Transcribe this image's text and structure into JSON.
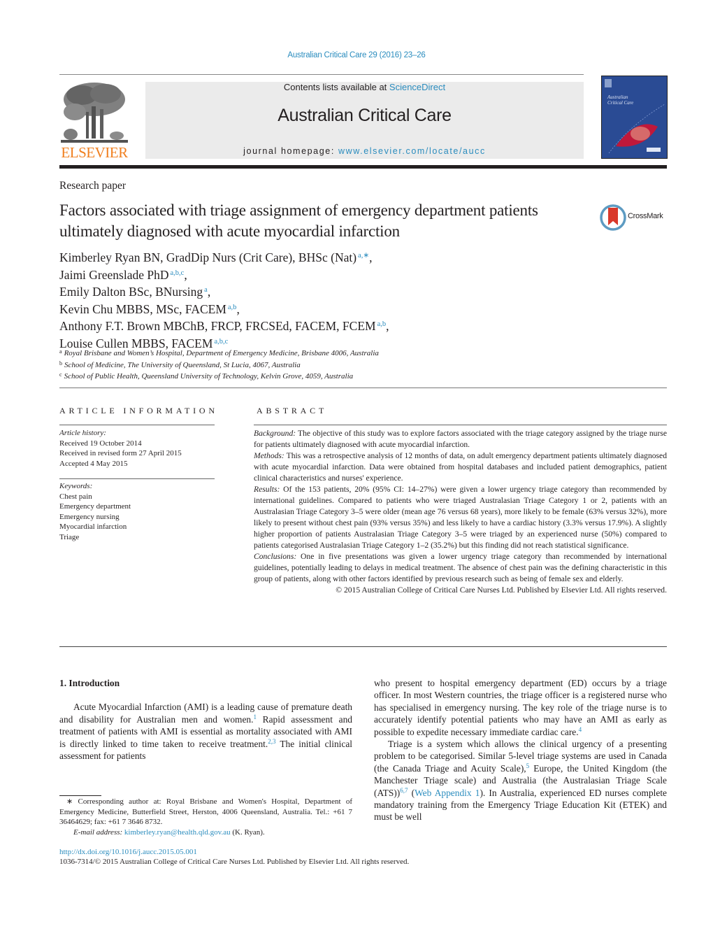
{
  "header": {
    "journal_reference": "Australian Critical Care 29 (2016) 23–26",
    "contents_prefix": "Contents lists available at ",
    "contents_link": "ScienceDirect",
    "journal_title": "Australian Critical Care",
    "homepage_prefix": "journal homepage: ",
    "homepage_link": "www.elsevier.com/locate/aucc",
    "publisher_logo": "ELSEVIER",
    "cover_title": "Australian Critical Care"
  },
  "article": {
    "type": "Research paper",
    "title": "Factors associated with triage assignment of emergency department patients ultimately diagnosed with acute myocardial infarction",
    "crossmark_label": "CrossMark",
    "authors": [
      {
        "name": "Kimberley Ryan BN, GradDip Nurs (Crit Care), BHSc (Nat)",
        "affil": "a,∗",
        "sep": ","
      },
      {
        "name": "Jaimi Greenslade PhD",
        "affil": "a,b,c",
        "sep": ","
      },
      {
        "name": "Emily Dalton BSc, BNursing",
        "affil": "a",
        "sep": ","
      },
      {
        "name": "Kevin Chu MBBS, MSc, FACEM",
        "affil": "a,b",
        "sep": ","
      },
      {
        "name": "Anthony F.T. Brown MBChB, FRCP, FRCSEd, FACEM, FCEM",
        "affil": "a,b",
        "sep": ","
      },
      {
        "name": "Louise Cullen MBBS, FACEM",
        "affil": "a,b,c",
        "sep": ""
      }
    ],
    "affiliations": [
      {
        "key": "a",
        "text": "Royal Brisbane and Women’s Hospital, Department of Emergency Medicine, Brisbane 4006, Australia"
      },
      {
        "key": "b",
        "text": "School of Medicine, The University of Queensland, St Lucia, 4067, Australia"
      },
      {
        "key": "c",
        "text": "School of Public Health, Queensland University of Technology, Kelvin Grove, 4059, Australia"
      }
    ]
  },
  "article_info": {
    "heading": "ARTICLE INFORMATION",
    "history_label": "Article history:",
    "history": [
      "Received 19 October 2014",
      "Received in revised form 27 April 2015",
      "Accepted 4 May 2015"
    ],
    "keywords_label": "Keywords:",
    "keywords": [
      "Chest pain",
      "Emergency department",
      "Emergency nursing",
      "Myocardial infarction",
      "Triage"
    ]
  },
  "abstract": {
    "heading": "ABSTRACT",
    "sections": [
      {
        "label": "Background:",
        "text": " The objective of this study was to explore factors associated with the triage category assigned by the triage nurse for patients ultimately diagnosed with acute myocardial infarction."
      },
      {
        "label": "Methods:",
        "text": " This was a retrospective analysis of 12 months of data, on adult emergency department patients ultimately diagnosed with acute myocardial infarction. Data were obtained from hospital databases and included patient demographics, patient clinical characteristics and nurses' experience."
      },
      {
        "label": "Results:",
        "text": " Of the 153 patients, 20% (95% CI: 14–27%) were given a lower urgency triage category than recommended by international guidelines. Compared to patients who were triaged Australasian Triage Category 1 or 2, patients with an Australasian Triage Category 3–5 were older (mean age 76 versus 68 years), more likely to be female (63% versus 32%), more likely to present without chest pain (93% versus 35%) and less likely to have a cardiac history (3.3% versus 17.9%). A slightly higher proportion of patients Australasian Triage Category 3–5 were triaged by an experienced nurse (50%) compared to patients categorised Australasian Triage Category 1–2 (35.2%) but this finding did not reach statistical significance."
      },
      {
        "label": "Conclusions:",
        "text": " One in five presentations was given a lower urgency triage category than recommended by international guidelines, potentially leading to delays in medical treatment. The absence of chest pain was the defining characteristic in this group of patients, along with other factors identified by previous research such as being of female sex and elderly."
      }
    ],
    "copyright": "© 2015 Australian College of Critical Care Nurses Ltd. Published by Elsevier Ltd. All rights reserved."
  },
  "body": {
    "intro_heading": "1.  Introduction",
    "left_p1_a": "Acute Myocardial Infarction (AMI) is a leading cause of premature death and disability for Australian men and women.",
    "left_p1_ref1": "1",
    "left_p1_b": " Rapid assessment and treatment of patients with AMI is essential as mortality associated with AMI is directly linked to time taken to receive treatment.",
    "left_p1_ref2": "2,3",
    "left_p1_c": " The initial clinical assessment for patients",
    "right_p1_a": "who present to hospital emergency department (ED) occurs by a triage officer. In most Western countries, the triage officer is a registered nurse who has specialised in emergency nursing. The key role of the triage nurse is to accurately identify potential patients who may have an AMI as early as possible to expedite necessary immediate cardiac care.",
    "right_p1_ref": "4",
    "right_p2_a": "Triage is a system which allows the clinical urgency of a presenting problem to be categorised. Similar 5-level triage systems are used in Canada (the Canada Triage and Acuity Scale),",
    "right_p2_ref1": "5",
    "right_p2_b": " Europe, the United Kingdom (the Manchester Triage scale) and Australia (the Australasian Triage Scale (ATS))",
    "right_p2_ref2": "6,7",
    "right_p2_c": " (",
    "right_p2_link": "Web Appendix 1",
    "right_p2_d": "). In Australia, experienced ED nurses complete mandatory training from the Emergency Triage Education Kit (ETEK) and must be well"
  },
  "footnote": {
    "corresponding": "∗  Corresponding author at: Royal Brisbane and Women's Hospital, Department of Emergency Medicine, Butterfield Street, Herston, 4006 Queensland, Australia. Tel.: +61 7 36464629; fax: +61 7 3646 8732.",
    "email_label": "E-mail address:",
    "email": "kimberley.ryan@health.qld.gov.au",
    "email_suffix": " (K. Ryan)."
  },
  "footer": {
    "doi": "http://dx.doi.org/10.1016/j.aucc.2015.05.001",
    "issn_copyright": "1036-7314/© 2015 Australian College of Critical Care Nurses Ltd. Published by Elsevier Ltd. All rights reserved."
  }
}
